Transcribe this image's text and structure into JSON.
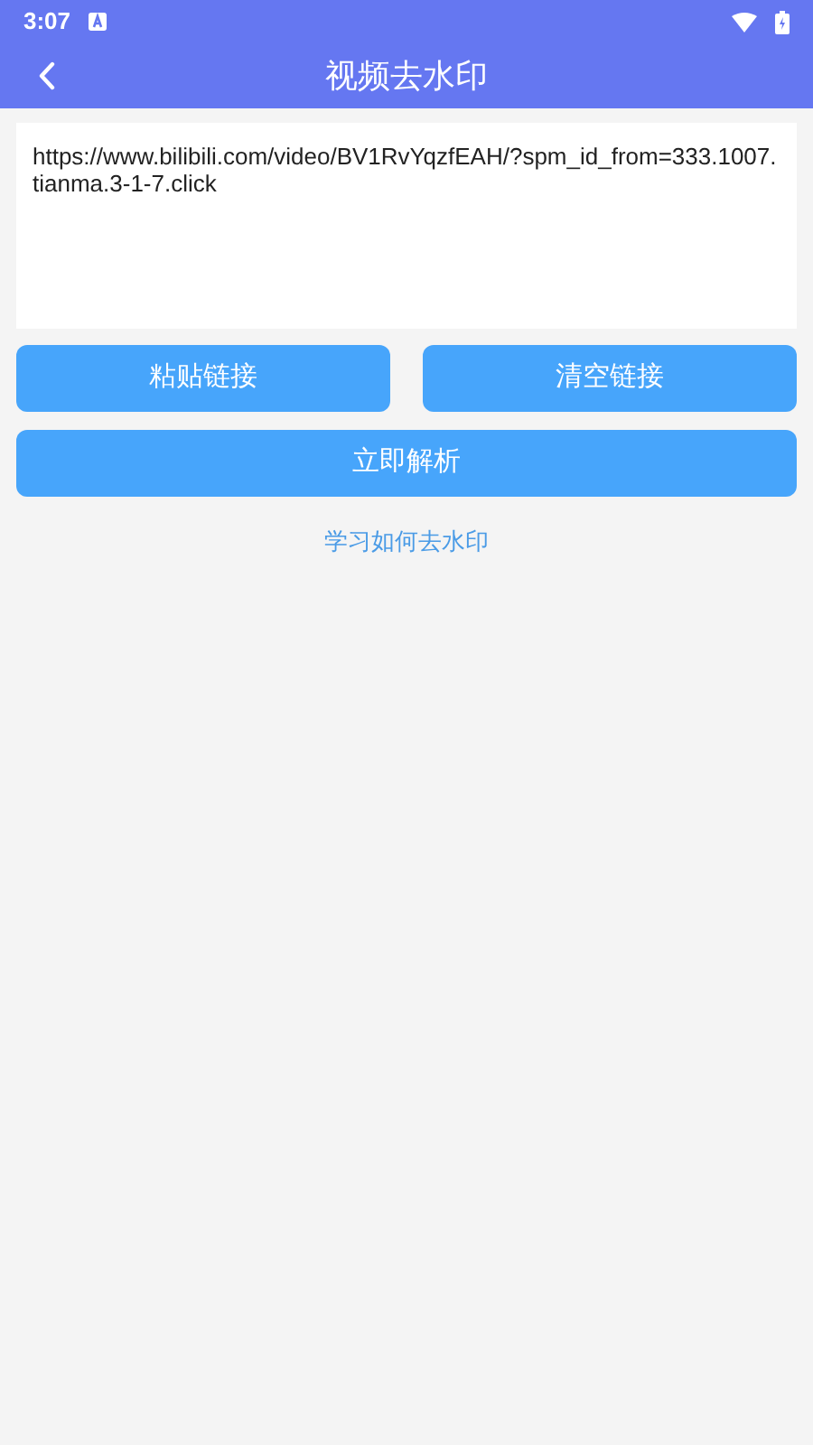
{
  "status_bar": {
    "time": "3:07"
  },
  "app_bar": {
    "title": "视频去水印"
  },
  "link_field": {
    "value": "https://www.bilibili.com/video/BV1RvYqzfEAH/?spm_id_from=333.1007.tianma.3-1-7.click"
  },
  "buttons": [
    {
      "label": "粘贴链接"
    },
    {
      "label": "清空链接"
    }
  ],
  "parse_button": {
    "label": "立即解析"
  },
  "help_link": {
    "label": "学习如何去水印"
  }
}
